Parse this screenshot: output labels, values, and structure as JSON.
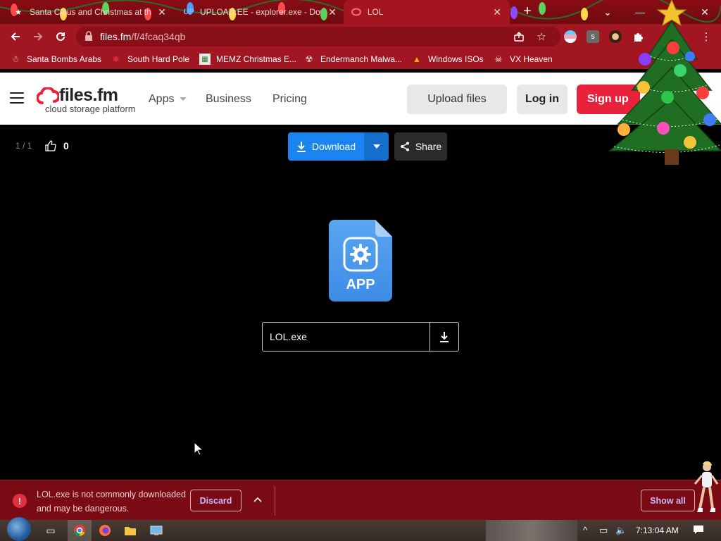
{
  "tabs": [
    {
      "title": "Santa Claus and Christmas at the",
      "favicon": "santa-icon"
    },
    {
      "title": "UPLOAD.EE - explorer.exe - Dow",
      "favicon": "upload-ee-icon"
    },
    {
      "title": "LOL",
      "favicon": "filesfm-icon",
      "active": true
    }
  ],
  "address_bar": {
    "host": "files.fm",
    "path": "/f/4fcaq34qb"
  },
  "bookmarks": [
    {
      "label": "Santa Bombs Arabs",
      "icon": "santa-icon"
    },
    {
      "label": "South Hard Pole",
      "icon": "snowflake-icon"
    },
    {
      "label": "MEMZ Christmas E...",
      "icon": "memz-icon"
    },
    {
      "label": "Endermanch Malwa...",
      "icon": "enderman-icon"
    },
    {
      "label": "Windows ISOs",
      "icon": "xmas-tree-icon"
    },
    {
      "label": "VX Heaven",
      "icon": "vx-heaven-icon"
    }
  ],
  "site": {
    "logo_word": "files.fm",
    "logo_tagline": "cloud storage platform",
    "nav": {
      "apps": "Apps",
      "business": "Business",
      "pricing": "Pricing"
    },
    "upload": "Upload files",
    "login": "Log in",
    "signup": "Sign up"
  },
  "viewer": {
    "counter": "1 / 1",
    "likes": "0",
    "download": "Download",
    "share": "Share",
    "file_type": "APP",
    "file_name": "LOL.exe"
  },
  "download_shelf": {
    "warning": "LOL.exe is not commonly downloaded and may be dangerous.",
    "discard": "Discard",
    "show_all": "Show all"
  },
  "taskbar": {
    "clock": "7:13:04 AM"
  },
  "colors": {
    "chrome": "#a21622",
    "download_blue": "#1a85f0",
    "signup_red": "#e8223b",
    "shelf": "#7a0b14"
  }
}
